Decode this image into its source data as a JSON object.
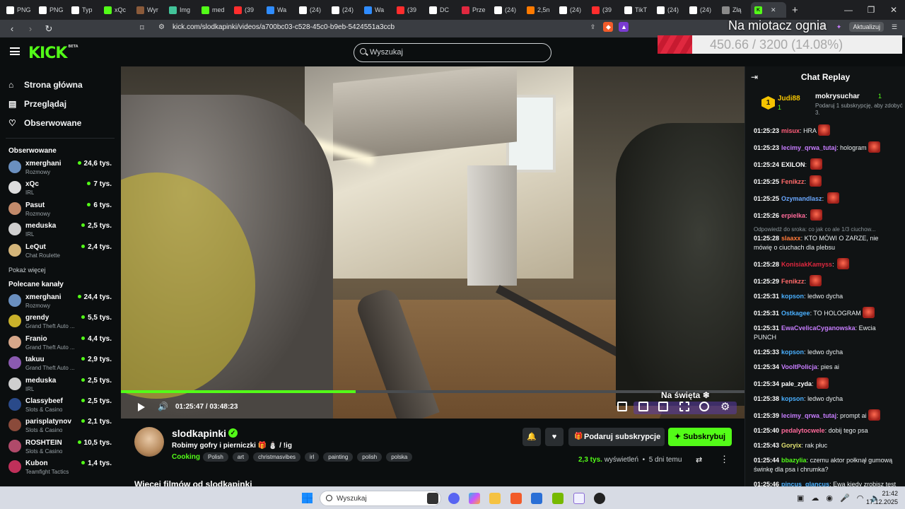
{
  "browser": {
    "tabs": [
      {
        "label": "PNG",
        "color": "#ffffff"
      },
      {
        "label": "PNG",
        "color": "#ffffff"
      },
      {
        "label": "Typ",
        "color": "#ffffff"
      },
      {
        "label": "xQc",
        "color": "#53fc18"
      },
      {
        "label": "Wyr",
        "color": "#8a5a3a"
      },
      {
        "label": "Img",
        "color": "#42c49a"
      },
      {
        "label": "med",
        "color": "#53fc18"
      },
      {
        "label": "(39",
        "color": "#ff2d2d"
      },
      {
        "label": "Wa",
        "color": "#2f8cff"
      },
      {
        "label": "(24)",
        "color": "#ffffff"
      },
      {
        "label": "(24)",
        "color": "#ffffff"
      },
      {
        "label": "Wa",
        "color": "#2f8cff"
      },
      {
        "label": "(39",
        "color": "#ff2d2d"
      },
      {
        "label": "DC",
        "color": "#ffffff"
      },
      {
        "label": "Prze",
        "color": "#e0283f"
      },
      {
        "label": "(24)",
        "color": "#ffffff"
      },
      {
        "label": "2,5n",
        "color": "#ff7a00"
      },
      {
        "label": "(24)",
        "color": "#ffffff"
      },
      {
        "label": "(39",
        "color": "#ff2d2d"
      },
      {
        "label": "TikT",
        "color": "#ffffff"
      },
      {
        "label": "(24)",
        "color": "#ffffff"
      },
      {
        "label": "(24)",
        "color": "#ffffff"
      },
      {
        "label": "Złą",
        "color": "#8a8a8a"
      }
    ],
    "url": "kick.com/slodkapinki/videos/a700bc03-c528-45c0-b9eb-5424551a3ccb",
    "update_button": "Aktualizuj"
  },
  "overlay": {
    "title": "Na miotacz ognia",
    "progress_text": "450.66 / 3200 (14.08%)",
    "progress_fraction": 0.1408
  },
  "header": {
    "logo": "KICK",
    "logo_badge": "BETA",
    "search_placeholder": "Wyszukaj"
  },
  "sidebar": {
    "nav": [
      {
        "label": "Strona główna",
        "icon": "home-icon"
      },
      {
        "label": "Przeglądaj",
        "icon": "browse-icon"
      },
      {
        "label": "Obserwowane",
        "icon": "heart-icon"
      }
    ],
    "followed_title": "Obserwowane",
    "followed": [
      {
        "name": "xmerghani",
        "category": "Rozmowy",
        "viewers": "24,6 tys.",
        "color": "#6a8fbf"
      },
      {
        "name": "xQc",
        "category": "IRL",
        "viewers": "7 tys.",
        "color": "#dddddd"
      },
      {
        "name": "Pasut",
        "category": "Rozmowy",
        "viewers": "6 tys.",
        "color": "#c28a6a"
      },
      {
        "name": "meduska",
        "category": "IRL",
        "viewers": "2,5 tys.",
        "color": "#cfcfcf"
      },
      {
        "name": "LeQut",
        "category": "Chat Roulette",
        "viewers": "2,4 tys.",
        "color": "#d4b57a"
      }
    ],
    "show_more": "Pokaż więcej",
    "recommended_title": "Polecane kanały",
    "recommended": [
      {
        "name": "xmerghani",
        "category": "Rozmowy",
        "viewers": "24,4 tys.",
        "color": "#6a8fbf"
      },
      {
        "name": "grendy",
        "category": "Grand Theft Auto ...",
        "viewers": "5,5 tys.",
        "color": "#c9b12a"
      },
      {
        "name": "Franio",
        "category": "Grand Theft Auto ...",
        "viewers": "4,4 tys.",
        "color": "#d6a78a"
      },
      {
        "name": "takuu",
        "category": "Grand Theft Auto ...",
        "viewers": "2,9 tys.",
        "color": "#8a5ab0"
      },
      {
        "name": "meduska",
        "category": "IRL",
        "viewers": "2,5 tys.",
        "color": "#cfcfcf"
      },
      {
        "name": "Classybeef",
        "category": "Slots & Casino",
        "viewers": "2,5 tys.",
        "color": "#2a4a8a"
      },
      {
        "name": "parisplatynov",
        "category": "Slots & Casino",
        "viewers": "2,1 tys.",
        "color": "#8a4a3a"
      },
      {
        "name": "ROSHTEIN",
        "category": "Slots & Casino",
        "viewers": "10,5 tys.",
        "color": "#b04a6a"
      },
      {
        "name": "Kubon",
        "category": "Teamfight Tactics",
        "viewers": "1,4 tys.",
        "color": "#c0305a"
      }
    ]
  },
  "player": {
    "progress_fraction": 0.376,
    "current_time": "01:25:47",
    "separator": "/",
    "duration": "03:48:23",
    "banner": "Na święta ❄"
  },
  "channel": {
    "name": "slodkapinki",
    "title": "Robimy gofry i pierniczki 🎁 ⛄ / !ig",
    "category": "Cooking",
    "tags": [
      "Polish",
      "art",
      "christmasvibes",
      "irl",
      "painting",
      "polish",
      "polska"
    ],
    "gift_button": "Podaruj subskrypcje",
    "subscribe_button": "Subskrybuj",
    "views": "2,3 tys.",
    "views_label": "wyświetleń",
    "age": "5 dni temu",
    "more_videos": "Więcej filmów od slodkapinki"
  },
  "chat": {
    "title": "Chat Replay",
    "leader1": {
      "name": "Judi88",
      "count": "1"
    },
    "leader2": {
      "name": "mokrysuchar",
      "count": "1"
    },
    "hint": "Podaruj 1 subskrypcję, aby zdobyć 3.",
    "messages": [
      {
        "time": "01:25:23",
        "user": "misux",
        "color": "#ff5e7a",
        "text": "HRA",
        "emote": true
      },
      {
        "time": "01:25:23",
        "user": "lecimy_qrwa_tutaj",
        "color": "#c77dff",
        "text": "hologram",
        "emote": true
      },
      {
        "time": "01:25:24",
        "user": "EXILON",
        "color": "#ffffff",
        "text": "",
        "emote": true
      },
      {
        "time": "01:25:25",
        "user": "Fenikzz",
        "color": "#ff6a6a",
        "text": "",
        "emote": true
      },
      {
        "time": "01:25:25",
        "user": "Ozymandlasz",
        "color": "#6aa8ff",
        "text": "",
        "emote": true
      },
      {
        "time": "01:25:26",
        "user": "erpielka",
        "color": "#ff6a9a",
        "text": "",
        "emote": true
      },
      {
        "time": "01:25:28",
        "user": "slaaxx",
        "color": "#ff7a3a",
        "text": "KTO MÓWI O ZARZE, nie mówię o ciuchach dla plebsu",
        "emote": false,
        "reply": "Odpowiedź do sroka: co jak co ale 1/3 ciuchow..."
      },
      {
        "time": "01:25:28",
        "user": "KonisiakKamyss",
        "color": "#e0283f",
        "text": "",
        "emote": true
      },
      {
        "time": "01:25:29",
        "user": "Fenikzz",
        "color": "#ff6a6a",
        "text": "",
        "emote": true
      },
      {
        "time": "01:25:31",
        "user": "kopson",
        "color": "#4ab0ff",
        "text": "ledwo dycha",
        "emote": false
      },
      {
        "time": "01:25:31",
        "user": "Ostkagee",
        "color": "#4ab0ff",
        "text": "TO HOLOGRAM",
        "emote": true
      },
      {
        "time": "01:25:31",
        "user": "EwaCvelicaCyganowska",
        "color": "#c77dff",
        "text": "Ewcia PUNCH",
        "emote": false
      },
      {
        "time": "01:25:33",
        "user": "kopson",
        "color": "#4ab0ff",
        "text": "ledwo dycha",
        "emote": false
      },
      {
        "time": "01:25:34",
        "user": "VooltPolicja",
        "color": "#c77dff",
        "text": "pies ai",
        "emote": false
      },
      {
        "time": "01:25:34",
        "user": "pale_zyda",
        "color": "#ffffff",
        "text": "",
        "emote": true
      },
      {
        "time": "01:25:38",
        "user": "kopson",
        "color": "#4ab0ff",
        "text": "ledwo dycha",
        "emote": false
      },
      {
        "time": "01:25:39",
        "user": "lecimy_qrwa_tutaj",
        "color": "#c77dff",
        "text": "prompt ai",
        "emote": true
      },
      {
        "time": "01:25:40",
        "user": "pedalytocwele",
        "color": "#ff6a9a",
        "text": "dobij tego psa",
        "emote": false
      },
      {
        "time": "01:25:43",
        "user": "Goryix",
        "color": "#e0e070",
        "text": "rak płuc",
        "emote": false
      },
      {
        "time": "01:25:44",
        "user": "bbazylia",
        "color": "#53fc18",
        "text": "czemu aktor połknął gumową świnkę dla psa i chrumka?",
        "emote": false
      },
      {
        "time": "01:25:46",
        "user": "pincus_glancus",
        "color": "#4ab0ff",
        "text": "Ewa kiedy zrobisz test dna na pochodzenie etniczne?",
        "emote": false
      }
    ]
  },
  "taskbar": {
    "search": "Wyszukaj",
    "time": "21:42",
    "date": "17.12.2025"
  }
}
